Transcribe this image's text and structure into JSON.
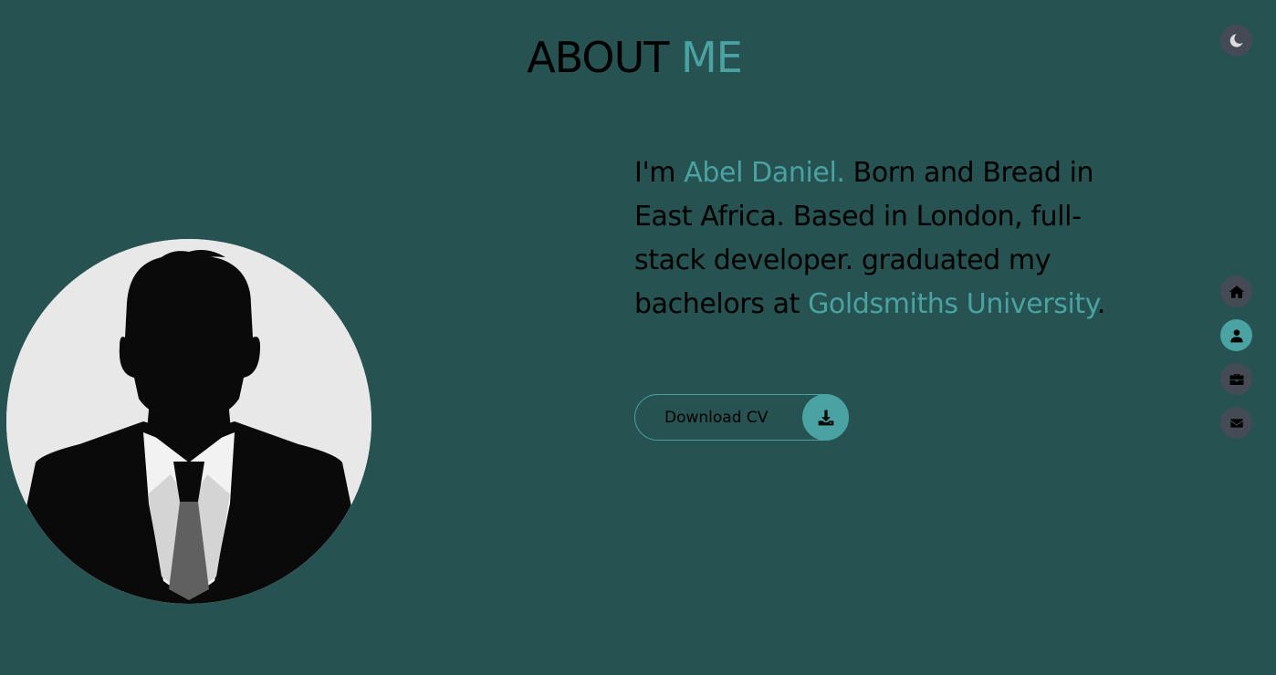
{
  "heading": {
    "part1": "ABOUT",
    "part2": "ME"
  },
  "bio": {
    "intro": "I'm ",
    "name": "Abel Daniel.",
    "middle": " Born and Bread in East Africa. Based in London, full-stack developer. graduated my bachelors at ",
    "school": "Goldsmiths University",
    "end": "."
  },
  "download": {
    "label": "Download CV",
    "icon": "download-icon"
  },
  "theme_toggle": {
    "icon": "moon-icon"
  },
  "nav": {
    "items": [
      {
        "icon": "home-icon",
        "active": false
      },
      {
        "icon": "user-icon",
        "active": true
      },
      {
        "icon": "briefcase-icon",
        "active": false
      },
      {
        "icon": "envelope-icon",
        "active": false
      }
    ]
  },
  "colors": {
    "background": "#265252",
    "accent": "#4aa2a2",
    "nav_button": "#454b54",
    "text": "#000000"
  }
}
